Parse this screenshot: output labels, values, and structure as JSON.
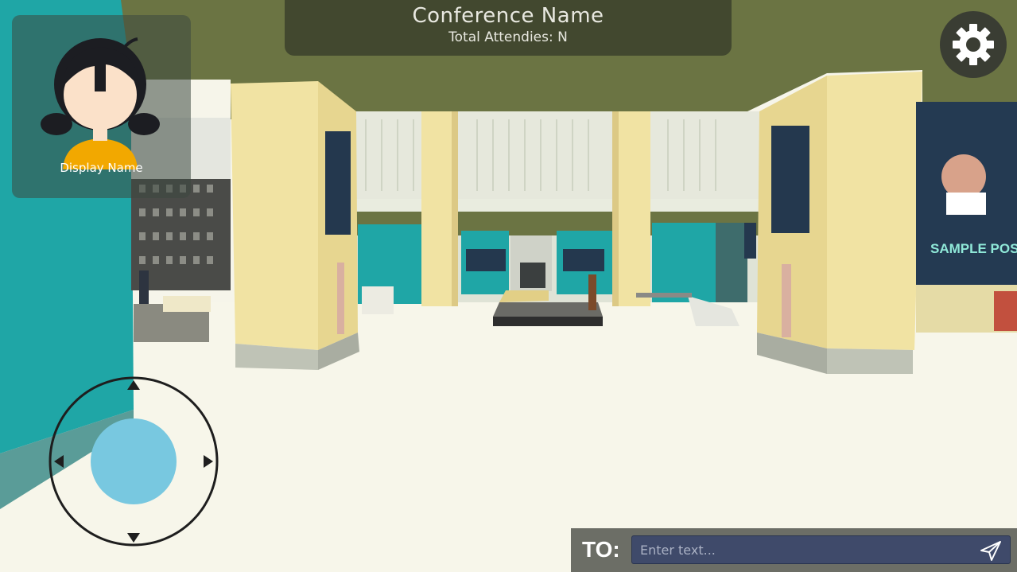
{
  "header": {
    "conference_name": "Conference Name",
    "attendees_text": "Total Attendies: N"
  },
  "profile": {
    "display_name": "Display Name",
    "avatar_icon": "avatar-girl-icon"
  },
  "settings": {
    "icon": "gear-icon"
  },
  "joystick": {
    "icons": [
      "arrow-up-icon",
      "arrow-down-icon",
      "arrow-left-icon",
      "arrow-right-icon"
    ],
    "knob_color": "#78c8e0"
  },
  "chat": {
    "to_label": "TO:",
    "placeholder": "Enter text...",
    "send_icon": "send-icon"
  },
  "scene": {
    "poster_text": "SAMPLE POSTER"
  },
  "colors": {
    "teal_wall": "#1fa6a6",
    "ceiling": "#6b7443",
    "pillar": "#f1e3a3",
    "floor": "#f7f6ea"
  }
}
